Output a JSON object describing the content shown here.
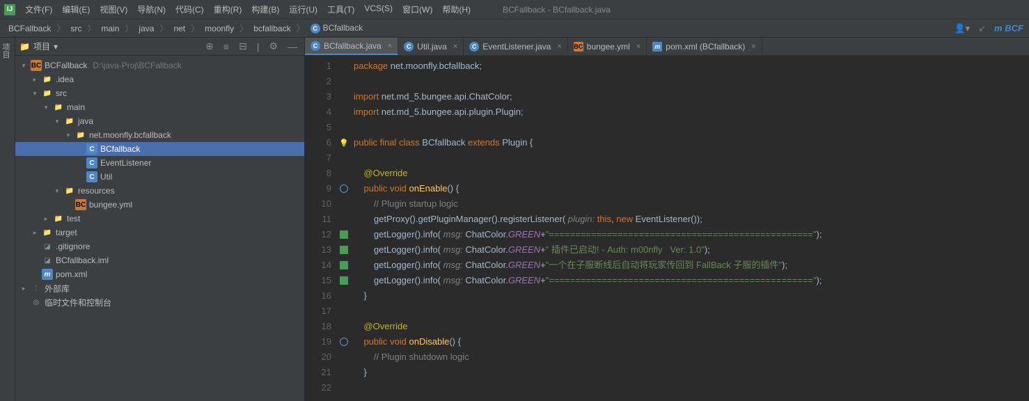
{
  "window_title": "BCFallback - BCfallback.java",
  "menubar": [
    "文件(F)",
    "编辑(E)",
    "视图(V)",
    "导航(N)",
    "代码(C)",
    "重构(R)",
    "构建(B)",
    "运行(U)",
    "工具(T)",
    "VCS(S)",
    "窗口(W)",
    "帮助(H)"
  ],
  "breadcrumb": [
    "BCFallback",
    "src",
    "main",
    "java",
    "net",
    "moonfly",
    "bcfallback",
    "BCfallback"
  ],
  "nav_right_badge": "BCF",
  "sidebar": {
    "title": "项目",
    "tree": [
      {
        "depth": 0,
        "arrow": "▾",
        "iconClass": "icon-bc",
        "iconText": "BC",
        "label": "BCFallback",
        "path": "D:\\java-Proj\\BCFallback",
        "selected": false
      },
      {
        "depth": 1,
        "arrow": "▸",
        "iconClass": "icon-folder",
        "iconText": "📁",
        "label": ".idea",
        "selected": false
      },
      {
        "depth": 1,
        "arrow": "▾",
        "iconClass": "icon-folder",
        "iconText": "📁",
        "label": "src",
        "selected": false
      },
      {
        "depth": 2,
        "arrow": "▾",
        "iconClass": "icon-folder",
        "iconText": "📁",
        "label": "main",
        "selected": false
      },
      {
        "depth": 3,
        "arrow": "▾",
        "iconClass": "icon-folder",
        "iconText": "📁",
        "label": "java",
        "selected": false
      },
      {
        "depth": 4,
        "arrow": "▾",
        "iconClass": "icon-folder",
        "iconText": "📁",
        "label": "net.moonfly.bcfallback",
        "selected": false
      },
      {
        "depth": 5,
        "arrow": "",
        "iconClass": "icon-c",
        "iconText": "C",
        "label": "BCfallback",
        "selected": true
      },
      {
        "depth": 5,
        "arrow": "",
        "iconClass": "icon-c",
        "iconText": "C",
        "label": "EventListener",
        "selected": false
      },
      {
        "depth": 5,
        "arrow": "",
        "iconClass": "icon-c",
        "iconText": "C",
        "label": "Util",
        "selected": false
      },
      {
        "depth": 3,
        "arrow": "▾",
        "iconClass": "icon-folder",
        "iconText": "📁",
        "label": "resources",
        "selected": false
      },
      {
        "depth": 4,
        "arrow": "",
        "iconClass": "icon-bc",
        "iconText": "BC",
        "label": "bungee.yml",
        "selected": false
      },
      {
        "depth": 2,
        "arrow": "▸",
        "iconClass": "icon-folder",
        "iconText": "📁",
        "label": "test",
        "selected": false
      },
      {
        "depth": 1,
        "arrow": "▸",
        "iconClass": "icon-folder-r",
        "iconText": "📁",
        "label": "target",
        "selected": false
      },
      {
        "depth": 1,
        "arrow": "",
        "iconClass": "icon-folder",
        "iconText": "◪",
        "label": ".gitignore",
        "selected": false
      },
      {
        "depth": 1,
        "arrow": "",
        "iconClass": "icon-folder",
        "iconText": "◪",
        "label": "BCfallback.iml",
        "selected": false
      },
      {
        "depth": 1,
        "arrow": "",
        "iconClass": "icon-m",
        "iconText": "m",
        "label": "pom.xml",
        "selected": false
      },
      {
        "depth": 0,
        "arrow": "▸",
        "iconClass": "icon-lib",
        "iconText": "⋮",
        "label": "外部库",
        "selected": false
      },
      {
        "depth": 0,
        "arrow": "",
        "iconClass": "icon-lib",
        "iconText": "◎",
        "label": "临时文件和控制台",
        "selected": false
      }
    ]
  },
  "tabs": [
    {
      "iconClass": "icon-c",
      "iconText": "C",
      "label": "BCfallback.java",
      "active": true
    },
    {
      "iconClass": "icon-c",
      "iconText": "C",
      "label": "Util.java",
      "active": false
    },
    {
      "iconClass": "icon-c",
      "iconText": "C",
      "label": "EventListener.java",
      "active": false
    },
    {
      "iconClass": "icon-bc",
      "iconText": "BC",
      "label": "bungee.yml",
      "active": false
    },
    {
      "iconClass": "icon-m",
      "iconText": "m",
      "label": "pom.xml (BCfallback)",
      "active": false
    }
  ],
  "code": {
    "lines": [
      {
        "n": 1,
        "marker": "",
        "tokens": [
          [
            "kw",
            "package "
          ],
          [
            "plain",
            "net.moonfly.bcfallback;"
          ]
        ]
      },
      {
        "n": 2,
        "marker": "",
        "tokens": []
      },
      {
        "n": 3,
        "marker": "",
        "tokens": [
          [
            "kw",
            "import "
          ],
          [
            "plain",
            "net.md_5.bungee.api.ChatColor;"
          ]
        ]
      },
      {
        "n": 4,
        "marker": "",
        "tokens": [
          [
            "kw",
            "import "
          ],
          [
            "plain",
            "net.md_5.bungee.api.plugin.Plugin;"
          ]
        ]
      },
      {
        "n": 5,
        "marker": "",
        "tokens": []
      },
      {
        "n": 6,
        "marker": "bulb",
        "tokens": [
          [
            "kw",
            "public final class "
          ],
          [
            "cls",
            "BCfallback"
          ],
          [
            "kw",
            " extends "
          ],
          [
            "plain",
            "Plugin {"
          ]
        ]
      },
      {
        "n": 7,
        "marker": "",
        "tokens": []
      },
      {
        "n": 8,
        "marker": "",
        "tokens": [
          [
            "plain",
            "    "
          ],
          [
            "ann",
            "@Override"
          ]
        ]
      },
      {
        "n": 9,
        "marker": "over",
        "tokens": [
          [
            "plain",
            "    "
          ],
          [
            "kw",
            "public void "
          ],
          [
            "fn",
            "onEnable"
          ],
          [
            "plain",
            "() {"
          ]
        ]
      },
      {
        "n": 10,
        "marker": "",
        "tokens": [
          [
            "plain",
            "        "
          ],
          [
            "comm",
            "// Plugin startup logic"
          ]
        ]
      },
      {
        "n": 11,
        "marker": "",
        "tokens": [
          [
            "plain",
            "        getProxy().getPluginManager().registerListener( "
          ],
          [
            "param",
            "plugin: "
          ],
          [
            "kw",
            "this"
          ],
          [
            "plain",
            ", "
          ],
          [
            "kw",
            "new "
          ],
          [
            "plain",
            "EventListener());"
          ]
        ]
      },
      {
        "n": 12,
        "marker": "green",
        "tokens": [
          [
            "plain",
            "        getLogger().info( "
          ],
          [
            "param",
            "msg: "
          ],
          [
            "plain",
            "ChatColor."
          ],
          [
            "green-f",
            "GREEN"
          ],
          [
            "plain",
            "+"
          ],
          [
            "str",
            "\"==================================================\""
          ],
          [
            "plain",
            ");"
          ]
        ]
      },
      {
        "n": 13,
        "marker": "green",
        "tokens": [
          [
            "plain",
            "        getLogger().info( "
          ],
          [
            "param",
            "msg: "
          ],
          [
            "plain",
            "ChatColor."
          ],
          [
            "green-f",
            "GREEN"
          ],
          [
            "plain",
            "+"
          ],
          [
            "str",
            "\" 插件已启动! - Auth: m00nfly   Ver: 1.0\""
          ],
          [
            "plain",
            ");"
          ]
        ]
      },
      {
        "n": 14,
        "marker": "green",
        "tokens": [
          [
            "plain",
            "        getLogger().info( "
          ],
          [
            "param",
            "msg: "
          ],
          [
            "plain",
            "ChatColor."
          ],
          [
            "green-f",
            "GREEN"
          ],
          [
            "plain",
            "+"
          ],
          [
            "str",
            "\"一个在子服断线后自动将玩家传回到 FallBack 子服的插件\""
          ],
          [
            "plain",
            ");"
          ]
        ]
      },
      {
        "n": 15,
        "marker": "green",
        "tokens": [
          [
            "plain",
            "        getLogger().info( "
          ],
          [
            "param",
            "msg: "
          ],
          [
            "plain",
            "ChatColor."
          ],
          [
            "green-f",
            "GREEN"
          ],
          [
            "plain",
            "+"
          ],
          [
            "str",
            "\"==================================================\""
          ],
          [
            "plain",
            ");"
          ]
        ]
      },
      {
        "n": 16,
        "marker": "",
        "tokens": [
          [
            "plain",
            "    }"
          ]
        ]
      },
      {
        "n": 17,
        "marker": "",
        "tokens": []
      },
      {
        "n": 18,
        "marker": "",
        "tokens": [
          [
            "plain",
            "    "
          ],
          [
            "ann",
            "@Override"
          ]
        ]
      },
      {
        "n": 19,
        "marker": "over",
        "tokens": [
          [
            "plain",
            "    "
          ],
          [
            "kw",
            "public void "
          ],
          [
            "fn",
            "onDisable"
          ],
          [
            "plain",
            "() {"
          ]
        ]
      },
      {
        "n": 20,
        "marker": "",
        "tokens": [
          [
            "plain",
            "        "
          ],
          [
            "comm",
            "// Plugin shutdown logic"
          ]
        ]
      },
      {
        "n": 21,
        "marker": "",
        "tokens": [
          [
            "plain",
            "    }"
          ]
        ]
      },
      {
        "n": 22,
        "marker": "",
        "tokens": []
      }
    ]
  }
}
